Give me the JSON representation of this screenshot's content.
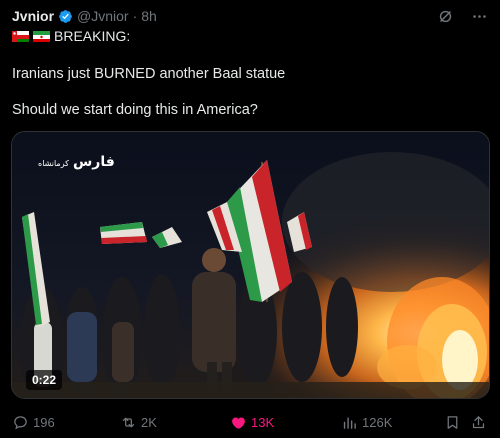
{
  "tweet": {
    "author_name": "Jvnior",
    "handle": "@Jvnior",
    "separator": "·",
    "time": "8h",
    "breaking_label": "BREAKING:",
    "line1": "Iranians just BURNED another Baal statue",
    "line2": "Should we start doing this in America?",
    "video_watermark": "فارس",
    "video_watermark_sub": "کرمانشاه",
    "video_duration": "0:22"
  },
  "actions": {
    "replies": "196",
    "reposts": "2K",
    "likes": "13K",
    "views": "126K"
  },
  "colors": {
    "verified": "#1d9bf0",
    "like_active": "#f91880",
    "muted": "#71767b"
  },
  "icons": [
    "verified-badge-icon",
    "grok-icon",
    "more-icon",
    "reply-icon",
    "retweet-icon",
    "heart-icon",
    "views-icon",
    "bookmark-icon",
    "share-icon"
  ]
}
